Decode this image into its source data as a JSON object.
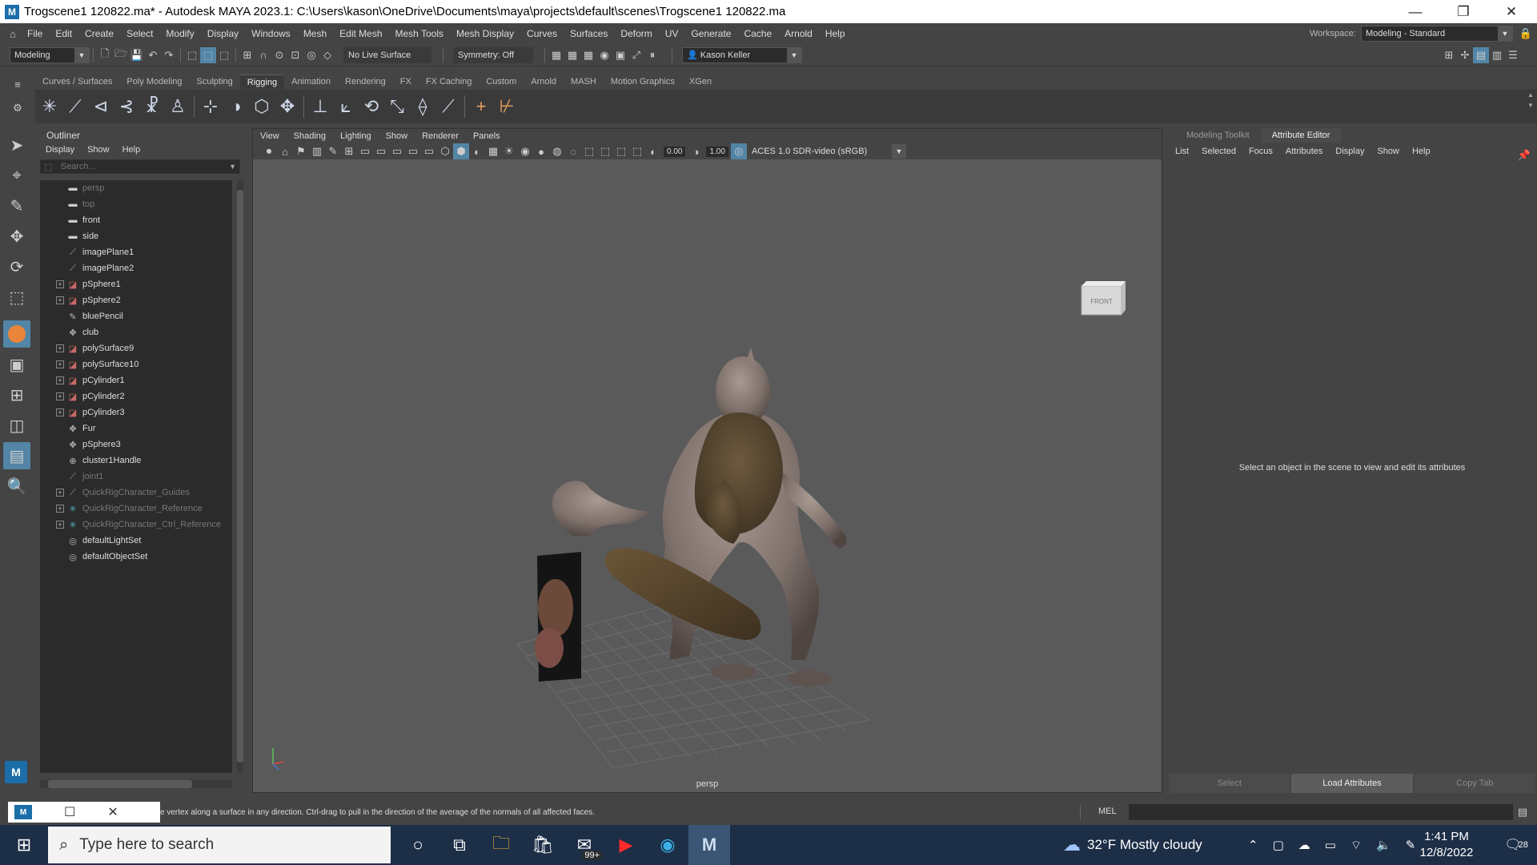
{
  "titlebar": {
    "app_icon": "M",
    "title": "Trogscene1 120822.ma* - Autodesk MAYA 2023.1: C:\\Users\\kason\\OneDrive\\Documents\\maya\\projects\\default\\scenes\\Trogscene1 120822.ma",
    "minimize": "—",
    "restore": "❐",
    "close": "✕"
  },
  "menubar": {
    "items": [
      "File",
      "Edit",
      "Create",
      "Select",
      "Modify",
      "Display",
      "Windows",
      "Mesh",
      "Edit Mesh",
      "Mesh Tools",
      "Mesh Display",
      "Curves",
      "Surfaces",
      "Deform",
      "UV",
      "Generate",
      "Cache",
      "Arnold",
      "Help"
    ],
    "workspace_label": "Workspace:",
    "workspace_value": "Modeling - Standard"
  },
  "statusline": {
    "menuset": "Modeling",
    "live_surface": "No Live Surface",
    "symmetry": "Symmetry: Off",
    "user": "Kason Keller"
  },
  "shelf": {
    "tabs": [
      "Curves / Surfaces",
      "Poly Modeling",
      "Sculpting",
      "Rigging",
      "Animation",
      "Rendering",
      "FX",
      "FX Caching",
      "Custom",
      "Arnold",
      "MASH",
      "Motion Graphics",
      "XGen"
    ],
    "active_tab": "Rigging"
  },
  "outliner": {
    "title": "Outliner",
    "menu": [
      "Display",
      "Show",
      "Help"
    ],
    "search_placeholder": "Search...",
    "items": [
      {
        "label": "persp",
        "icon": "camera",
        "expandable": false,
        "dim": true
      },
      {
        "label": "top",
        "icon": "camera",
        "expandable": false,
        "dim": true
      },
      {
        "label": "front",
        "icon": "camera",
        "expandable": false,
        "dim": false
      },
      {
        "label": "side",
        "icon": "camera",
        "expandable": false,
        "dim": false
      },
      {
        "label": "imagePlane1",
        "icon": "imageplane",
        "expandable": false,
        "dim": false
      },
      {
        "label": "imagePlane2",
        "icon": "imageplane",
        "expandable": false,
        "dim": false
      },
      {
        "label": "pSphere1",
        "icon": "mesh",
        "expandable": true,
        "dim": false
      },
      {
        "label": "pSphere2",
        "icon": "mesh",
        "expandable": true,
        "dim": false
      },
      {
        "label": "bluePencil",
        "icon": "pencil",
        "expandable": false,
        "dim": false
      },
      {
        "label": "club",
        "icon": "transform",
        "expandable": false,
        "dim": false
      },
      {
        "label": "polySurface9",
        "icon": "mesh",
        "expandable": true,
        "dim": false
      },
      {
        "label": "polySurface10",
        "icon": "mesh",
        "expandable": true,
        "dim": false
      },
      {
        "label": "pCylinder1",
        "icon": "mesh",
        "expandable": true,
        "dim": false
      },
      {
        "label": "pCylinder2",
        "icon": "mesh",
        "expandable": true,
        "dim": false
      },
      {
        "label": "pCylinder3",
        "icon": "mesh",
        "expandable": true,
        "dim": false
      },
      {
        "label": "Fur",
        "icon": "transform",
        "expandable": false,
        "dim": false
      },
      {
        "label": "pSphere3",
        "icon": "transform",
        "expandable": false,
        "dim": false
      },
      {
        "label": "cluster1Handle",
        "icon": "cluster",
        "expandable": false,
        "dim": false
      },
      {
        "label": "joint1",
        "icon": "joint",
        "expandable": false,
        "dim": true
      },
      {
        "label": "QuickRigCharacter_Guides",
        "icon": "joint",
        "expandable": true,
        "dim": true
      },
      {
        "label": "QuickRigCharacter_Reference",
        "icon": "rig",
        "expandable": true,
        "dim": true
      },
      {
        "label": "QuickRigCharacter_Ctrl_Reference",
        "icon": "rig",
        "expandable": true,
        "dim": true
      },
      {
        "label": "defaultLightSet",
        "icon": "set",
        "expandable": false,
        "dim": false
      },
      {
        "label": "defaultObjectSet",
        "icon": "set",
        "expandable": false,
        "dim": false
      }
    ]
  },
  "viewport": {
    "menu": [
      "View",
      "Shading",
      "Lighting",
      "Show",
      "Renderer",
      "Panels"
    ],
    "exposure": "0.00",
    "gamma": "1.00",
    "color_space": "ACES 1.0 SDR-video (sRGB)",
    "camera_label": "persp",
    "viewcube_label": "FRONT"
  },
  "rightpanel": {
    "tabs": [
      "Modeling Toolkit",
      "Attribute Editor"
    ],
    "active_tab": "Attribute Editor",
    "menu": [
      "List",
      "Selected",
      "Focus",
      "Attributes",
      "Display",
      "Show",
      "Help"
    ],
    "message": "Select an object in the scene to view and edit its attributes",
    "buttons": [
      "Select",
      "Load Attributes",
      "Copy Tab"
    ]
  },
  "helpline": {
    "text": "e vertex along a surface in any direction. Ctrl-drag to pull in the direction of the average of the normals of all affected faces.",
    "mel_label": "MEL"
  },
  "taskbar": {
    "search_placeholder": "Type here to search",
    "mail_badge": "99+",
    "weather": "32°F  Mostly cloudy",
    "time": "1:41 PM",
    "date": "12/8/2022",
    "notifications": "28"
  }
}
